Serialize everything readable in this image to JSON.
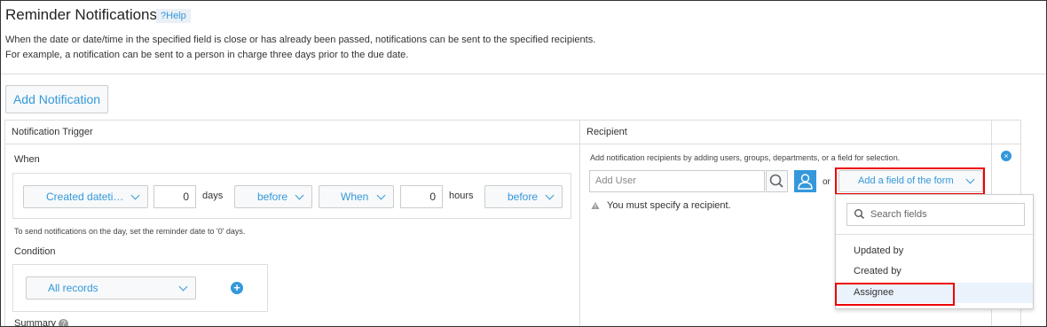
{
  "header": {
    "title": "Reminder Notifications",
    "help_label": "Help",
    "description_line1": "When the date or date/time in the specified field is close or has already been passed, notifications can be sent to the specified recipients.",
    "description_line2": "For example, a notification can be sent to a person in charge three days prior to the due date."
  },
  "toolbar": {
    "add_notification_label": "Add Notification"
  },
  "table": {
    "col_trigger": "Notification Trigger",
    "col_recipient": "Recipient"
  },
  "trigger": {
    "when_label": "When",
    "date_field": "Created dateti…",
    "days_value": "0",
    "days_unit": "days",
    "days_relation": "before",
    "when_select": "When",
    "hours_value": "0",
    "hours_unit": "hours",
    "hours_relation": "before",
    "hint": "To send notifications on the day, set the reminder date to '0' days.",
    "condition_label": "Condition",
    "condition_value": "All records",
    "summary_label": "Summary"
  },
  "recipient": {
    "instructions": "Add notification recipients by adding users, groups, departments, or a field for selection.",
    "add_user_placeholder": "Add User",
    "or_label": "or",
    "add_field_label": "Add a field of the form",
    "warning": "You must specify a recipient."
  },
  "field_dropdown": {
    "search_placeholder": "Search fields",
    "options": [
      "Updated by",
      "Created by",
      "Assignee"
    ],
    "selected": "Assignee"
  },
  "colors": {
    "accent": "#3498db",
    "highlight": "#e00000"
  }
}
